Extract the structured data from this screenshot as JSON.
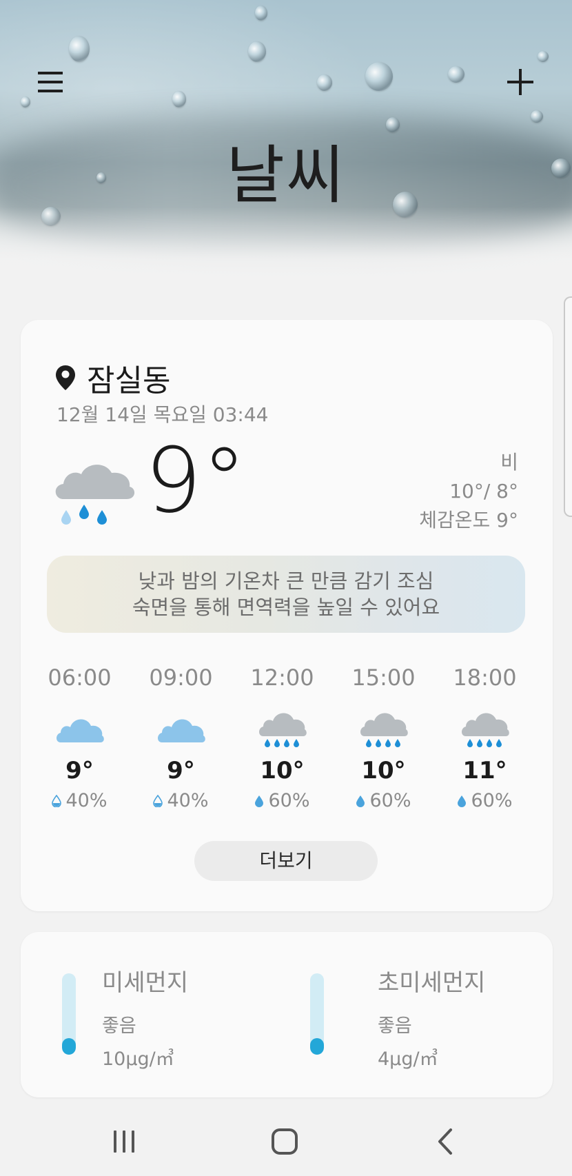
{
  "header": {
    "title": "날씨",
    "menu_icon": "hamburger-menu-icon",
    "add_icon": "plus-icon"
  },
  "current": {
    "location": "잠실동",
    "datetime": "12월 14일 목요일 03:44",
    "temperature": "9°",
    "condition": "비",
    "high_low": "10°/ 8°",
    "feels_like": "체감온도 9°",
    "icon": "rain-cloud-icon"
  },
  "advice": {
    "line1": "낮과 밤의 기온차 큰 만큼 감기 조심",
    "line2": "숙면을 통해 면역력을 높일 수 있어요"
  },
  "hourly": [
    {
      "time": "06:00",
      "temp": "9°",
      "rain": "40%",
      "icon": "cloudy-icon"
    },
    {
      "time": "09:00",
      "temp": "9°",
      "rain": "40%",
      "icon": "cloudy-icon"
    },
    {
      "time": "12:00",
      "temp": "10°",
      "rain": "60%",
      "icon": "rain-cloud-icon"
    },
    {
      "time": "15:00",
      "temp": "10°",
      "rain": "60%",
      "icon": "rain-cloud-icon"
    },
    {
      "time": "18:00",
      "temp": "11°",
      "rain": "60%",
      "icon": "rain-cloud-icon"
    }
  ],
  "more_label": "더보기",
  "dust": {
    "pm10": {
      "title": "미세먼지",
      "level": "좋음",
      "value": "10μg/㎥",
      "fill_fraction": 0.2
    },
    "pm25": {
      "title": "초미세먼지",
      "level": "좋음",
      "value": "4μg/㎥",
      "fill_fraction": 0.2
    }
  },
  "colors": {
    "accent_blue": "#23a7d8",
    "cloud_blue": "#8cc4ea",
    "cloud_gray": "#b7bcc0",
    "rain_drop": "#1e8fd6"
  },
  "navbar": {
    "recent_icon": "recent-apps-icon",
    "home_icon": "home-icon",
    "back_icon": "back-icon"
  }
}
